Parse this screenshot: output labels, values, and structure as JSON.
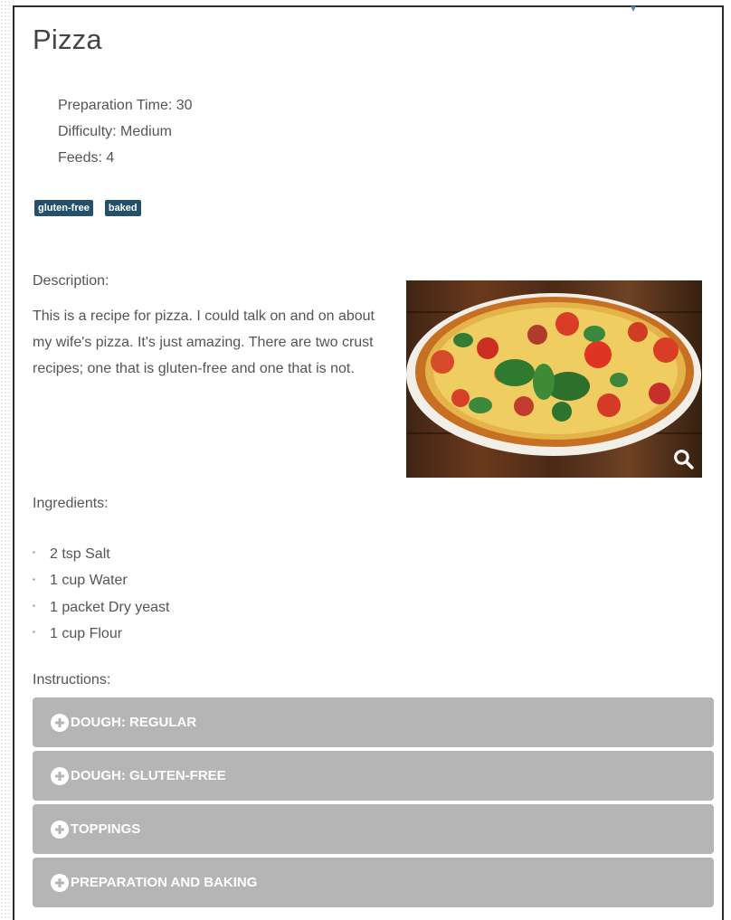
{
  "recipe": {
    "title": "Pizza",
    "meta": {
      "prep": "Preparation Time: 30",
      "difficulty": "Difficulty: Medium",
      "feeds": "Feeds: 4"
    },
    "tags": [
      "gluten-free",
      "baked"
    ],
    "labels": {
      "description": "Description:",
      "ingredients": "Ingredients:",
      "instructions": "Instructions:"
    },
    "description": "This is a recipe for pizza. I could talk on and on about my wife's pizza. It's just amazing. There are two crust recipes; one that is gluten-free and one that is not.",
    "ingredients": [
      "2 tsp Salt",
      "1 cup Water",
      "1 packet Dry yeast",
      "1 cup Flour"
    ],
    "instructions": [
      "DOUGH: REGULAR",
      "DOUGH: GLUTEN-FREE",
      "TOPPINGS",
      "PREPARATION AND BAKING"
    ]
  },
  "colors": {
    "tag_bg": "#24506b",
    "accordion_bg": "#b5b5b5",
    "text": "#555555"
  },
  "icons": {
    "magnify": "search-icon",
    "expand": "plus-circle-icon"
  }
}
